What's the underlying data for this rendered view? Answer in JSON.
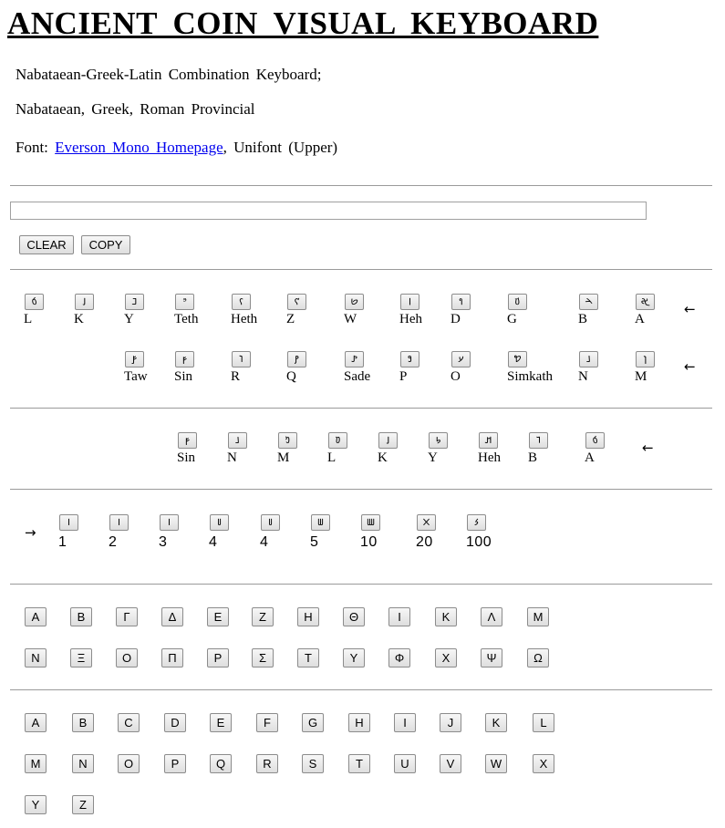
{
  "page": {
    "title": "ANCIENT COIN VISUAL KEYBOARD",
    "subtitle": "Nabataean-Greek-Latin Combination Keyboard;",
    "scripts": "Nabataean, Greek, Roman Provincial",
    "font_prefix": "Font: ",
    "font_link": "Everson Mono Homepage",
    "font_suffix": ", Unifont (Upper)"
  },
  "editor": {
    "value": "",
    "clear_label": "CLEAR",
    "copy_label": "COPY"
  },
  "nabataean_row1": [
    {
      "glyph": "𐢁",
      "label": "L"
    },
    {
      "glyph": "𐢑",
      "label": "K"
    },
    {
      "glyph": "𐢏",
      "label": "Y"
    },
    {
      "glyph": "𐢎",
      "label": "Teth"
    },
    {
      "glyph": "𐢍",
      "label": "Heth"
    },
    {
      "glyph": "𐢌",
      "label": "Z"
    },
    {
      "glyph": "𐢋",
      "label": "W"
    },
    {
      "glyph": "𐢉",
      "label": "Heh"
    },
    {
      "glyph": "𐢈",
      "label": "D"
    },
    {
      "glyph": "𐢆",
      "label": "G"
    },
    {
      "glyph": "𐢄",
      "label": "B"
    },
    {
      "glyph": "𐢀",
      "label": "A"
    }
  ],
  "nabataean_row2": [
    {
      "glyph": "𐢝",
      "label": "Taw"
    },
    {
      "glyph": "𐢜",
      "label": "Sin"
    },
    {
      "glyph": "𐢛",
      "label": "R"
    },
    {
      "glyph": "𐢚",
      "label": "Q"
    },
    {
      "glyph": "𐢙",
      "label": "Sade"
    },
    {
      "glyph": "𐢘",
      "label": "P"
    },
    {
      "glyph": "𐢗",
      "label": "O"
    },
    {
      "glyph": "𐢖",
      "label": "Simkath"
    },
    {
      "glyph": "𐢕",
      "label": "N"
    },
    {
      "glyph": "𐢔",
      "label": "M"
    }
  ],
  "variant_row": [
    {
      "glyph": "𐢜",
      "label": "Sin"
    },
    {
      "glyph": "𐢕",
      "label": "N"
    },
    {
      "glyph": "𐢓",
      "label": "M"
    },
    {
      "glyph": "𐢒",
      "label": "L"
    },
    {
      "glyph": "𐢑",
      "label": "K"
    },
    {
      "glyph": "𐢐",
      "label": "Y"
    },
    {
      "glyph": "𐢊",
      "label": "Heh"
    },
    {
      "glyph": "𐢅",
      "label": "B"
    },
    {
      "glyph": "𐢁",
      "label": "A"
    }
  ],
  "numerals": [
    {
      "glyph": "𐢧",
      "label": "1"
    },
    {
      "glyph": "𐢧",
      "label": "2"
    },
    {
      "glyph": "𐢧",
      "label": "3"
    },
    {
      "glyph": "𐢨",
      "label": "4"
    },
    {
      "glyph": "𐢨",
      "label": "4"
    },
    {
      "glyph": "𐢩",
      "label": "5"
    },
    {
      "glyph": "𐢪",
      "label": "10"
    },
    {
      "glyph": "𐢫",
      "label": "20"
    },
    {
      "glyph": "𐢬",
      "label": "100"
    }
  ],
  "arrows": {
    "left": "←",
    "right": "→"
  },
  "greek_row1": [
    "A",
    "B",
    "Γ",
    "Δ",
    "Ε",
    "Z",
    "H",
    "Θ",
    "I",
    "K",
    "Λ",
    "M"
  ],
  "greek_row2": [
    "N",
    "Ξ",
    "O",
    "Π",
    "P",
    "Σ",
    "T",
    "Y",
    "Φ",
    "X",
    "Ψ",
    "Ω"
  ],
  "latin_row1": [
    "A",
    "B",
    "C",
    "D",
    "E",
    "F",
    "G",
    "H",
    "I",
    "J",
    "K",
    "L"
  ],
  "latin_row2": [
    "M",
    "N",
    "O",
    "P",
    "Q",
    "R",
    "S",
    "T",
    "U",
    "V",
    "W",
    "X"
  ],
  "latin_row3": [
    "Y",
    "Z"
  ]
}
